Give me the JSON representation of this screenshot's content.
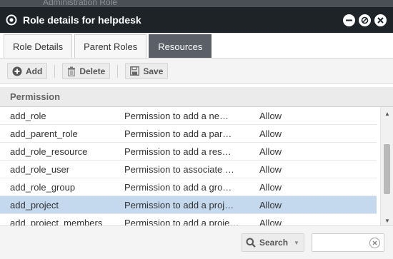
{
  "window": {
    "title": "Role details for helpdesk",
    "background_text": "Administration Role"
  },
  "tabs": [
    {
      "label": "Role Details",
      "active": false
    },
    {
      "label": "Parent Roles",
      "active": false
    },
    {
      "label": "Resources",
      "active": true
    }
  ],
  "toolbar": {
    "add_label": "Add",
    "delete_label": "Delete",
    "save_label": "Save"
  },
  "grid": {
    "header": "Permission",
    "rows": [
      {
        "name": "add_role",
        "description": "Permission to add a ne…",
        "value": "Allow",
        "selected": false
      },
      {
        "name": "add_parent_role",
        "description": "Permission to add a par…",
        "value": "Allow",
        "selected": false
      },
      {
        "name": "add_role_resource",
        "description": "Permission to add a res…",
        "value": "Allow",
        "selected": false
      },
      {
        "name": "add_role_user",
        "description": "Permission to associate …",
        "value": "Allow",
        "selected": false
      },
      {
        "name": "add_role_group",
        "description": "Permission to add a gro…",
        "value": "Allow",
        "selected": false
      },
      {
        "name": "add_project",
        "description": "Permission to add a proj…",
        "value": "Allow",
        "selected": true
      },
      {
        "name": "add_project_members",
        "description": "Permission to add a proje…",
        "value": "Allow",
        "selected": false
      }
    ]
  },
  "footer": {
    "search_label": "Search",
    "search_value": ""
  },
  "colors": {
    "titlebar": "#1e2328",
    "active_tab": "#5b6068",
    "selected_row": "#c4d9ee"
  }
}
